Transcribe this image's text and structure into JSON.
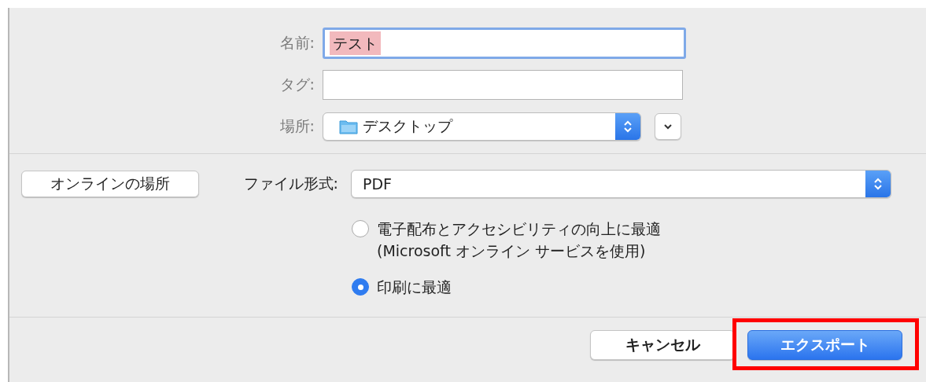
{
  "save_fields": [
    {
      "kind": "text",
      "label": "名前:",
      "value": "テスト",
      "focused": true,
      "text_selected": true
    },
    {
      "kind": "text",
      "label": "タグ:",
      "focused": false
    },
    {
      "kind": "popup",
      "label": "場所:",
      "value": "デスクトップ"
    }
  ],
  "online_button": "オンラインの場所",
  "file_format": {
    "label": "ファイル形式:",
    "value": "PDF"
  },
  "options": [
    {
      "label": "電子配布とアクセシビリティの向上に最適\n(Microsoft オンライン サービスを使用)",
      "selected": false
    },
    {
      "label": "印刷に最適",
      "selected": true
    }
  ],
  "buttons": [
    {
      "label": "キャンセル",
      "kind": "normal",
      "highlighted": false
    },
    {
      "label": "エクスポート",
      "kind": "default",
      "highlighted": true
    }
  ]
}
